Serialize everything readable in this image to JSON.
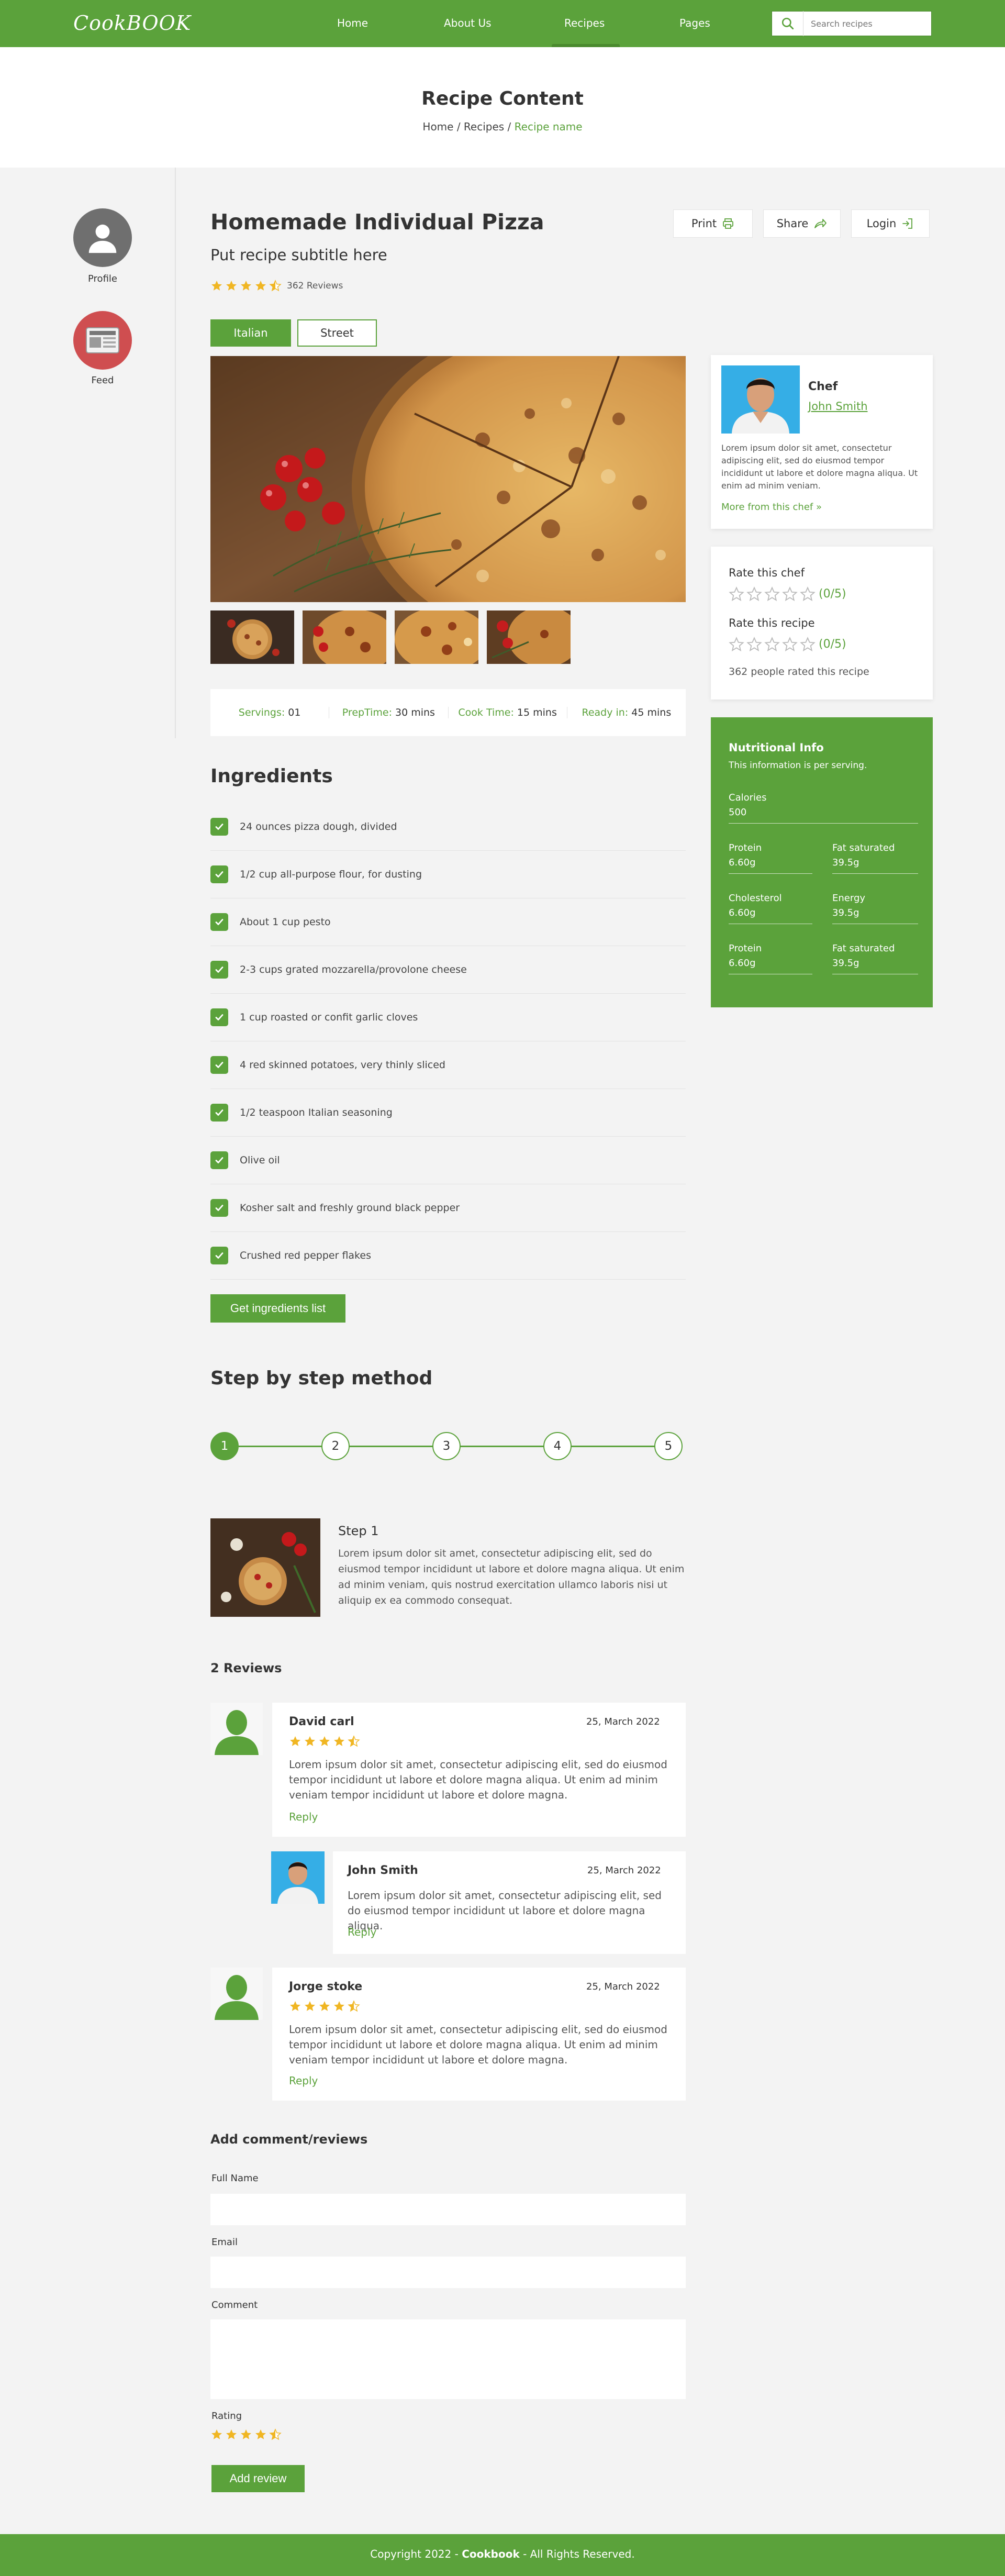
{
  "nav": {
    "logo": "CookBOOK",
    "links": [
      "Home",
      "About Us",
      "Recipes",
      "Pages"
    ],
    "active": "Recipes",
    "search_placeholder": "Search recipes"
  },
  "hero": {
    "title": "Recipe Content",
    "crumb_home": "Home",
    "crumb_sep": " / ",
    "crumb_recipes": "Recipes",
    "crumb_current": "Recipe name"
  },
  "sidebar": {
    "profile_label": "Profile",
    "feed_label": "Feed"
  },
  "recipe": {
    "title": "Homemade Individual Pizza",
    "subtitle": "Put recipe subtitle here",
    "rating": 4.5,
    "reviews": "362 Reviews",
    "actions": {
      "print": "Print",
      "share": "Share",
      "login": "Login"
    },
    "tags": [
      "Italian",
      "Street"
    ],
    "info": [
      {
        "key": "Servings:",
        "value": " 01"
      },
      {
        "key": "PrepTime:",
        "value": " 30 mins"
      },
      {
        "key": "Cook Time:",
        "value": " 15 mins"
      },
      {
        "key": "Ready in:",
        "value": " 45 mins"
      }
    ]
  },
  "chef": {
    "role": "Chef",
    "name": "John Smith",
    "bio": "Lorem ipsum dolor sit amet, consectetur adipiscing elit, sed do eiusmod tempor incididunt ut labore et dolore magna aliqua. Ut enim ad minim veniam.",
    "more_link": "More from this chef",
    "more_arrow": "»"
  },
  "rating": {
    "chef_title": "Rate this chef",
    "chef_score": "(0/5)",
    "recipe_title": "Rate this recipe",
    "recipe_score": "(0/5)",
    "summary": "362 people rated this recipe"
  },
  "nutrition": {
    "title": "Nutritional Info",
    "subtitle": "This information is per serving.",
    "calories": {
      "label": "Calories",
      "value": "500"
    },
    "grid": [
      {
        "label": "Protein",
        "value": "6.60g"
      },
      {
        "label": "Fat saturated",
        "value": "39.5g"
      },
      {
        "label": "Cholesterol",
        "value": "6.60g"
      },
      {
        "label": "Energy",
        "value": "39.5g"
      },
      {
        "label": "Protein",
        "value": "6.60g"
      },
      {
        "label": "Fat saturated",
        "value": "39.5g"
      }
    ]
  },
  "ingredients": {
    "title": "Ingredients",
    "items": [
      "24 ounces pizza dough, divided",
      "1/2 cup all-purpose flour, for dusting",
      "About 1 cup pesto",
      "2-3 cups grated mozzarella/provolone cheese",
      "1 cup roasted or confit garlic cloves",
      "4 red skinned potatoes, very thinly sliced",
      "1/2 teaspoon Italian seasoning",
      "Olive oil",
      "Kosher salt and freshly ground black pepper",
      "Crushed red pepper flakes"
    ],
    "button": "Get ingredients list"
  },
  "steps": {
    "title": "Step by step method",
    "numbers": [
      "1",
      "2",
      "3",
      "4",
      "5"
    ],
    "active": 1,
    "current_title": "Step 1",
    "current_text": "Lorem ipsum dolor sit amet, consectetur adipiscing elit, sed do eiusmod tempor incididunt ut labore et dolore magna aliqua. Ut enim ad minim veniam, quis nostrud exercitation ullamco laboris nisi ut aliquip ex ea commodo consequat."
  },
  "reviews": {
    "title": "2 Reviews",
    "reply_label": "Reply",
    "items": [
      {
        "name": "David carl",
        "date": "25, March 2022",
        "rating": 4.5,
        "text": "Lorem ipsum dolor sit amet, consectetur adipiscing elit, sed do eiusmod tempor incididunt ut labore et dolore magna aliqua. Ut enim ad minim veniam tempor incididunt ut labore et dolore magna."
      },
      {
        "name": "John Smith",
        "date": "25, March 2022",
        "text": "Lorem ipsum dolor sit amet, consectetur adipiscing elit, sed do eiusmod tempor incididunt ut labore et dolore magna aliqua."
      },
      {
        "name": "Jorge stoke",
        "date": "25, March 2022",
        "rating": 4.5,
        "text": "Lorem ipsum dolor sit amet, consectetur adipiscing elit, sed do eiusmod tempor incididunt ut labore et dolore magna aliqua. Ut enim ad minim veniam tempor incididunt ut labore et dolore magna."
      }
    ]
  },
  "comment_form": {
    "title": "Add comment/reviews",
    "full_name_label": "Full Name",
    "email_label": "Email",
    "comment_label": "Comment",
    "rating_label": "Rating",
    "rating": 4.5,
    "submit": "Add review"
  },
  "footer": {
    "prefix": "Copyright 2022 - ",
    "brand": "Cookbook",
    "suffix": " - All Rights Reserved."
  },
  "colors": {
    "accent": "#5ba23b",
    "star": "#f0b623",
    "star_empty": "#bbbbbb"
  },
  "icons": {
    "search": "search-icon",
    "print": "printer-icon",
    "share": "share-arrow-icon",
    "login": "login-icon",
    "check": "check-icon",
    "star": "star-icon"
  }
}
